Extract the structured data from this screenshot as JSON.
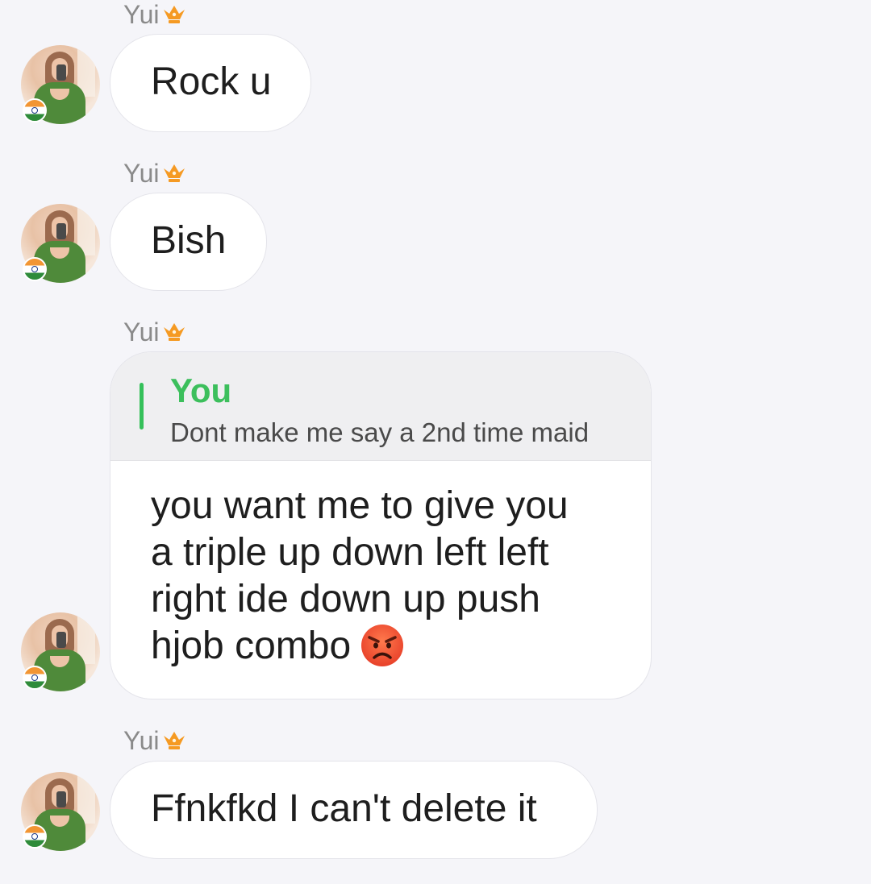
{
  "messages": [
    {
      "sender": "Yui",
      "text": "Rock u"
    },
    {
      "sender": "Yui",
      "text": "Bish"
    },
    {
      "sender": "Yui",
      "reply_to": {
        "author": "You",
        "text": "Dont make me say a 2nd time maid"
      },
      "lines": [
        "you want me to give you",
        "a triple up down left left",
        "right ide down up push",
        "hjob combo"
      ],
      "emoji": "angry-face-emoji"
    },
    {
      "sender": "Yui",
      "text": "Ffnkfkd I can't delete it"
    }
  ],
  "icons": {
    "crown": "crown-icon",
    "flag": "india-flag-icon"
  },
  "colors": {
    "background": "#f5f5f9",
    "quote_accent": "#35c05a",
    "crown": "#f59a23"
  }
}
